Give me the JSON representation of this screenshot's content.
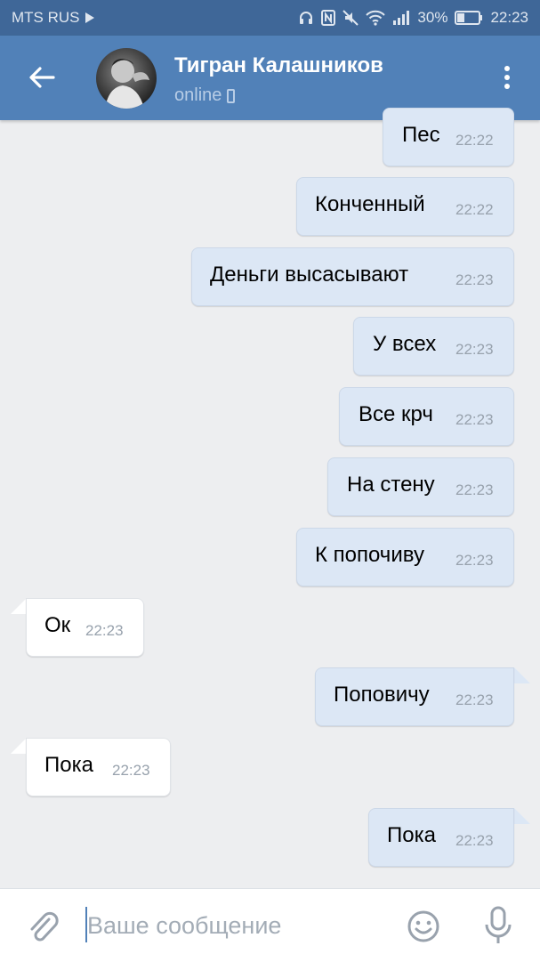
{
  "statusbar": {
    "carrier": "MTS RUS",
    "battery": "30%",
    "time": "22:23",
    "icons": [
      "play-icon",
      "headphones-icon",
      "nfc-icon",
      "mute-icon",
      "wifi-icon",
      "signal-icon",
      "battery-icon"
    ]
  },
  "header": {
    "name": "Тигран Калашников",
    "status": "online",
    "icons": [
      "back-arrow-icon",
      "avatar",
      "mobile-icon",
      "more-vert-icon"
    ]
  },
  "messages": [
    {
      "dir": "out",
      "text": "Пес",
      "time": "22:22"
    },
    {
      "dir": "out",
      "text": "Конченный",
      "time": "22:22"
    },
    {
      "dir": "out",
      "text": "Деньги высасывают",
      "time": "22:23"
    },
    {
      "dir": "out",
      "text": "У всех",
      "time": "22:23"
    },
    {
      "dir": "out",
      "text": "Все крч",
      "time": "22:23"
    },
    {
      "dir": "out",
      "text": "На стену",
      "time": "22:23"
    },
    {
      "dir": "out",
      "text": "К попочиву",
      "time": "22:23"
    },
    {
      "dir": "in",
      "text": "Ок",
      "time": "22:23"
    },
    {
      "dir": "out",
      "text": "Поповичу",
      "time": "22:23"
    },
    {
      "dir": "in",
      "text": "Пока",
      "time": "22:23"
    },
    {
      "dir": "out",
      "text": "Пока",
      "time": "22:23"
    }
  ],
  "composer": {
    "placeholder": "Ваше сообщение",
    "icons": [
      "paperclip-icon",
      "emoji-icon",
      "microphone-icon"
    ]
  },
  "colors": {
    "header": "#5181b8",
    "statusbar": "#3f6798",
    "outgoing_bubble": "#dce7f5",
    "incoming_bubble": "#ffffff",
    "background": "#edeef0"
  }
}
